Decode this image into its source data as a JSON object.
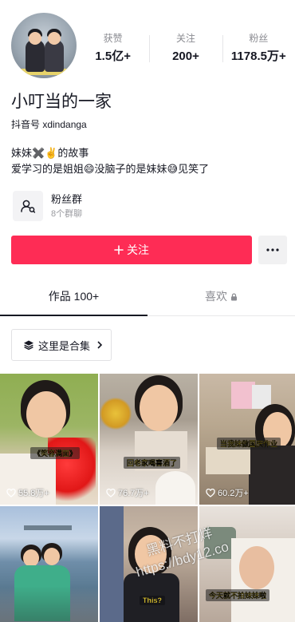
{
  "profile": {
    "name": "小叮当的一家",
    "douyin_id": "抖音号 xdindanga",
    "avatar_icon": "family-avatar-photo"
  },
  "stats": [
    {
      "label": "获赞",
      "value": "1.5亿+"
    },
    {
      "label": "关注",
      "value": "200+"
    },
    {
      "label": "粉丝",
      "value": "1178.5万+"
    }
  ],
  "bio": {
    "line1": "妹妹✖️✌️的故事",
    "line2": "爱学习的是姐姐😄没脑子的是妹妹😅见笑了"
  },
  "fan_group": {
    "title": "粉丝群",
    "subtitle": "8个群聊",
    "icon": "group-chat-icon"
  },
  "actions": {
    "follow_label": "关注",
    "follow_icon": "plus-icon",
    "more_icon": "more-dots-icon"
  },
  "tabs": [
    {
      "label": "作品 100+"
    },
    {
      "label": "喜欢"
    }
  ],
  "collection": {
    "label": "这里是合集",
    "icon": "stack-icon"
  },
  "videos": [
    {
      "caption": "《笑容满面》",
      "likes": "55.8万+"
    },
    {
      "caption": "回老家喝喜酒了",
      "likes": "76.7万+"
    },
    {
      "caption": "当我妹做国庆作业",
      "likes": "60.2万+"
    },
    {
      "caption": "",
      "likes": ""
    },
    {
      "caption": "This?",
      "likes": ""
    },
    {
      "caption": "今天就不拍妹妹啦",
      "likes": ""
    }
  ],
  "watermark": {
    "line1": "黑料不打烊",
    "line2": "https://bdy12.co"
  },
  "colors": {
    "accent": "#fe2c55",
    "text": "#161823",
    "muted": "#8a8b91"
  }
}
